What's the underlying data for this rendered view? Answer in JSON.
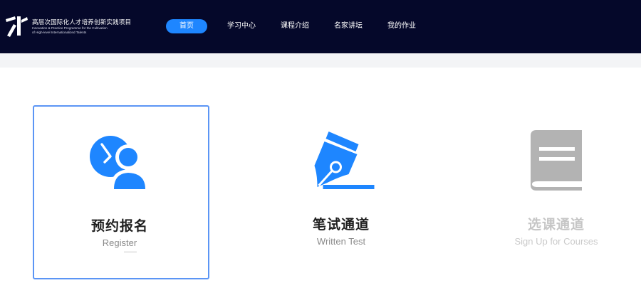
{
  "header": {
    "logo_title": "高层次国际化人才培养创新实践项目",
    "logo_subtitle_line1": "Innovation & Practice Programme for the Cultivation",
    "logo_subtitle_line2": "of High-level Internationalized Talents",
    "nav": [
      {
        "label": "首页",
        "active": true
      },
      {
        "label": "学习中心",
        "active": false
      },
      {
        "label": "课程介绍",
        "active": false
      },
      {
        "label": "名家讲坛",
        "active": false
      },
      {
        "label": "我的作业",
        "active": false
      }
    ]
  },
  "cards": [
    {
      "title": "预约报名",
      "subtitle": "Register",
      "icon": "user-clock-icon",
      "state": "selected"
    },
    {
      "title": "笔试通道",
      "subtitle": "Written Test",
      "icon": "pen-nib-icon",
      "state": "normal"
    },
    {
      "title": "选课通道",
      "subtitle": "Sign Up for Courses",
      "icon": "book-icon",
      "state": "disabled"
    }
  ],
  "colors": {
    "header_bg": "#05082a",
    "accent": "#1e86ff",
    "selected_border": "#5b95f5",
    "disabled": "#b3b3b3"
  }
}
